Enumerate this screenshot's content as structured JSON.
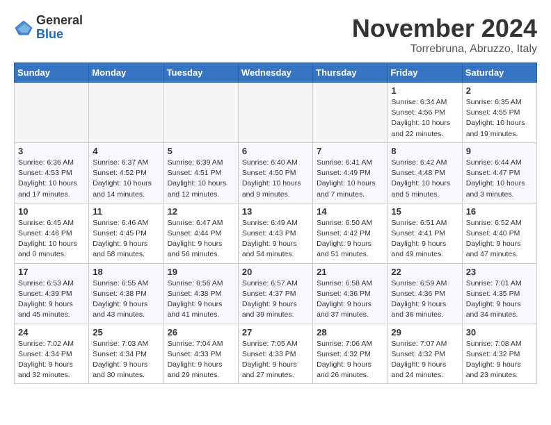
{
  "logo": {
    "text_general": "General",
    "text_blue": "Blue"
  },
  "title": "November 2024",
  "location": "Torrebruna, Abruzzo, Italy",
  "days_of_week": [
    "Sunday",
    "Monday",
    "Tuesday",
    "Wednesday",
    "Thursday",
    "Friday",
    "Saturday"
  ],
  "weeks": [
    {
      "days": [
        {
          "num": "",
          "empty": true
        },
        {
          "num": "",
          "empty": true
        },
        {
          "num": "",
          "empty": true
        },
        {
          "num": "",
          "empty": true
        },
        {
          "num": "",
          "empty": true
        },
        {
          "num": "1",
          "sunrise": "6:34 AM",
          "sunset": "4:56 PM",
          "daylight": "10 hours and 22 minutes."
        },
        {
          "num": "2",
          "sunrise": "6:35 AM",
          "sunset": "4:55 PM",
          "daylight": "10 hours and 19 minutes."
        }
      ]
    },
    {
      "days": [
        {
          "num": "3",
          "sunrise": "6:36 AM",
          "sunset": "4:53 PM",
          "daylight": "10 hours and 17 minutes."
        },
        {
          "num": "4",
          "sunrise": "6:37 AM",
          "sunset": "4:52 PM",
          "daylight": "10 hours and 14 minutes."
        },
        {
          "num": "5",
          "sunrise": "6:39 AM",
          "sunset": "4:51 PM",
          "daylight": "10 hours and 12 minutes."
        },
        {
          "num": "6",
          "sunrise": "6:40 AM",
          "sunset": "4:50 PM",
          "daylight": "10 hours and 9 minutes."
        },
        {
          "num": "7",
          "sunrise": "6:41 AM",
          "sunset": "4:49 PM",
          "daylight": "10 hours and 7 minutes."
        },
        {
          "num": "8",
          "sunrise": "6:42 AM",
          "sunset": "4:48 PM",
          "daylight": "10 hours and 5 minutes."
        },
        {
          "num": "9",
          "sunrise": "6:44 AM",
          "sunset": "4:47 PM",
          "daylight": "10 hours and 3 minutes."
        }
      ]
    },
    {
      "days": [
        {
          "num": "10",
          "sunrise": "6:45 AM",
          "sunset": "4:46 PM",
          "daylight": "10 hours and 0 minutes."
        },
        {
          "num": "11",
          "sunrise": "6:46 AM",
          "sunset": "4:45 PM",
          "daylight": "9 hours and 58 minutes."
        },
        {
          "num": "12",
          "sunrise": "6:47 AM",
          "sunset": "4:44 PM",
          "daylight": "9 hours and 56 minutes."
        },
        {
          "num": "13",
          "sunrise": "6:49 AM",
          "sunset": "4:43 PM",
          "daylight": "9 hours and 54 minutes."
        },
        {
          "num": "14",
          "sunrise": "6:50 AM",
          "sunset": "4:42 PM",
          "daylight": "9 hours and 51 minutes."
        },
        {
          "num": "15",
          "sunrise": "6:51 AM",
          "sunset": "4:41 PM",
          "daylight": "9 hours and 49 minutes."
        },
        {
          "num": "16",
          "sunrise": "6:52 AM",
          "sunset": "4:40 PM",
          "daylight": "9 hours and 47 minutes."
        }
      ]
    },
    {
      "days": [
        {
          "num": "17",
          "sunrise": "6:53 AM",
          "sunset": "4:39 PM",
          "daylight": "9 hours and 45 minutes."
        },
        {
          "num": "18",
          "sunrise": "6:55 AM",
          "sunset": "4:38 PM",
          "daylight": "9 hours and 43 minutes."
        },
        {
          "num": "19",
          "sunrise": "6:56 AM",
          "sunset": "4:38 PM",
          "daylight": "9 hours and 41 minutes."
        },
        {
          "num": "20",
          "sunrise": "6:57 AM",
          "sunset": "4:37 PM",
          "daylight": "9 hours and 39 minutes."
        },
        {
          "num": "21",
          "sunrise": "6:58 AM",
          "sunset": "4:36 PM",
          "daylight": "9 hours and 37 minutes."
        },
        {
          "num": "22",
          "sunrise": "6:59 AM",
          "sunset": "4:36 PM",
          "daylight": "9 hours and 36 minutes."
        },
        {
          "num": "23",
          "sunrise": "7:01 AM",
          "sunset": "4:35 PM",
          "daylight": "9 hours and 34 minutes."
        }
      ]
    },
    {
      "days": [
        {
          "num": "24",
          "sunrise": "7:02 AM",
          "sunset": "4:34 PM",
          "daylight": "9 hours and 32 minutes."
        },
        {
          "num": "25",
          "sunrise": "7:03 AM",
          "sunset": "4:34 PM",
          "daylight": "9 hours and 30 minutes."
        },
        {
          "num": "26",
          "sunrise": "7:04 AM",
          "sunset": "4:33 PM",
          "daylight": "9 hours and 29 minutes."
        },
        {
          "num": "27",
          "sunrise": "7:05 AM",
          "sunset": "4:33 PM",
          "daylight": "9 hours and 27 minutes."
        },
        {
          "num": "28",
          "sunrise": "7:06 AM",
          "sunset": "4:32 PM",
          "daylight": "9 hours and 26 minutes."
        },
        {
          "num": "29",
          "sunrise": "7:07 AM",
          "sunset": "4:32 PM",
          "daylight": "9 hours and 24 minutes."
        },
        {
          "num": "30",
          "sunrise": "7:08 AM",
          "sunset": "4:32 PM",
          "daylight": "9 hours and 23 minutes."
        }
      ]
    }
  ],
  "labels": {
    "sunrise": "Sunrise:",
    "sunset": "Sunset:",
    "daylight": "Daylight:"
  }
}
